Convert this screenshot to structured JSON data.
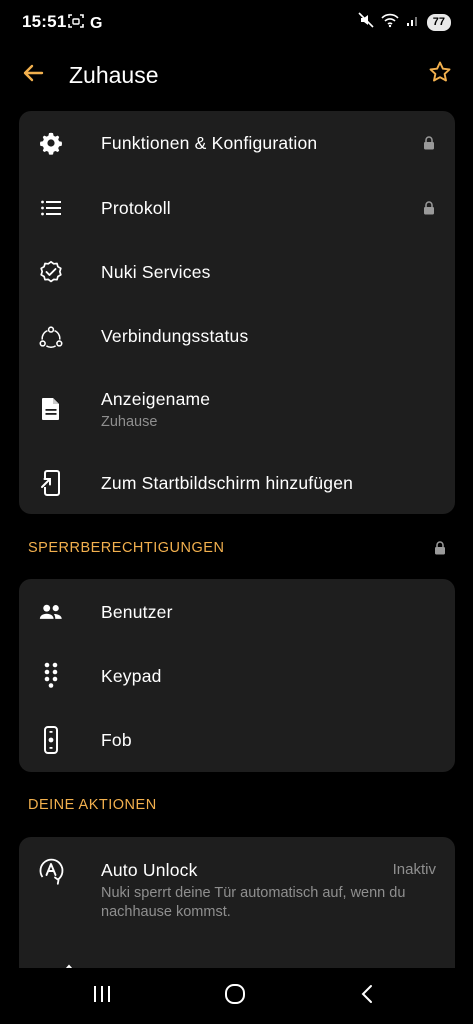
{
  "status_bar": {
    "time": "15:51",
    "g_label": "G",
    "battery": "77"
  },
  "header": {
    "title": "Zuhause",
    "back_icon": "arrow-left-icon",
    "favorite_icon": "star-outline-icon"
  },
  "colors": {
    "accent": "#f2b04e",
    "background": "#000000",
    "card": "#1e1e1e",
    "secondary_text": "#8f8f8f"
  },
  "main_menu": [
    {
      "label": "Funktionen & Konfiguration",
      "icon": "gear-icon",
      "locked": true
    },
    {
      "label": "Protokoll",
      "icon": "list-icon",
      "locked": true
    },
    {
      "label": "Nuki Services",
      "icon": "verified-badge-icon",
      "locked": false
    },
    {
      "label": "Verbindungsstatus",
      "icon": "connection-nodes-icon",
      "locked": false
    },
    {
      "label": "Anzeigename",
      "sublabel": "Zuhause",
      "icon": "document-icon",
      "locked": false
    },
    {
      "label": "Zum Startbildschirm hinzufügen",
      "icon": "add-to-homescreen-icon",
      "locked": false
    }
  ],
  "permissions_section": {
    "title": "SPERRBERECHTIGUNGEN",
    "locked": true,
    "items": [
      {
        "label": "Benutzer",
        "icon": "users-icon"
      },
      {
        "label": "Keypad",
        "icon": "keypad-icon"
      },
      {
        "label": "Fob",
        "icon": "fob-icon"
      }
    ]
  },
  "actions_section": {
    "title": "DEINE AKTIONEN",
    "items": [
      {
        "label": "Auto Unlock",
        "status": "Inaktiv",
        "description": "Nuki sperrt deine Tür automatisch auf, wenn du nachhause kommst.",
        "icon": "auto-unlock-icon"
      }
    ]
  },
  "nav_bar": {
    "recents_icon": "recents-icon",
    "home_icon": "home-circle-icon",
    "back_icon": "nav-back-icon"
  }
}
